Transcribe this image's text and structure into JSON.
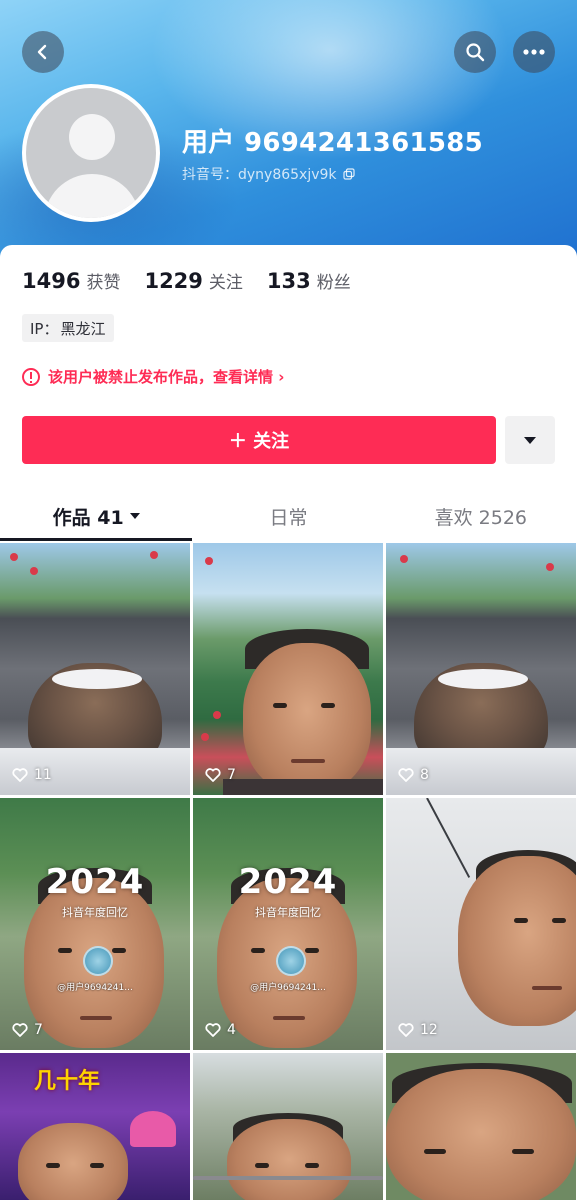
{
  "header": {
    "username": "用户 9694241361585",
    "douyin_id": "抖音号：dyny865xjv9k"
  },
  "stats": {
    "likes_count": "1496",
    "likes_label": "获赞",
    "following_count": "1229",
    "following_label": "关注",
    "followers_count": "133",
    "followers_label": "粉丝"
  },
  "ip": {
    "label": "IP：",
    "region": "黑龙江"
  },
  "warning": {
    "text": "该用户被禁止发布作品，查看详情 ›"
  },
  "actions": {
    "follow_label": "＋ 关注"
  },
  "tabs": [
    {
      "label": "作品 41",
      "active": true
    },
    {
      "label": "日常",
      "active": false
    },
    {
      "label": "喜欢 2526",
      "active": false
    }
  ],
  "grid": [
    {
      "likes": "11"
    },
    {
      "likes": "7"
    },
    {
      "likes": "8"
    },
    {
      "likes": "7",
      "overlay_year": "2024",
      "overlay_sub": "抖音年度回忆",
      "watermark": "@用户9694241..."
    },
    {
      "likes": "4",
      "overlay_year": "2024",
      "overlay_sub": "抖音年度回忆",
      "watermark": "@用户9694241..."
    },
    {
      "likes": "12"
    },
    {
      "overlay_title": "几十年"
    },
    {},
    {}
  ],
  "colors": {
    "accent": "#fe2c55",
    "header_blue": "#2f8fdc"
  },
  "icons": [
    "back-arrow-icon",
    "search-icon",
    "more-icon",
    "copy-icon",
    "warning-icon",
    "chevron-down-icon",
    "heart-icon"
  ]
}
